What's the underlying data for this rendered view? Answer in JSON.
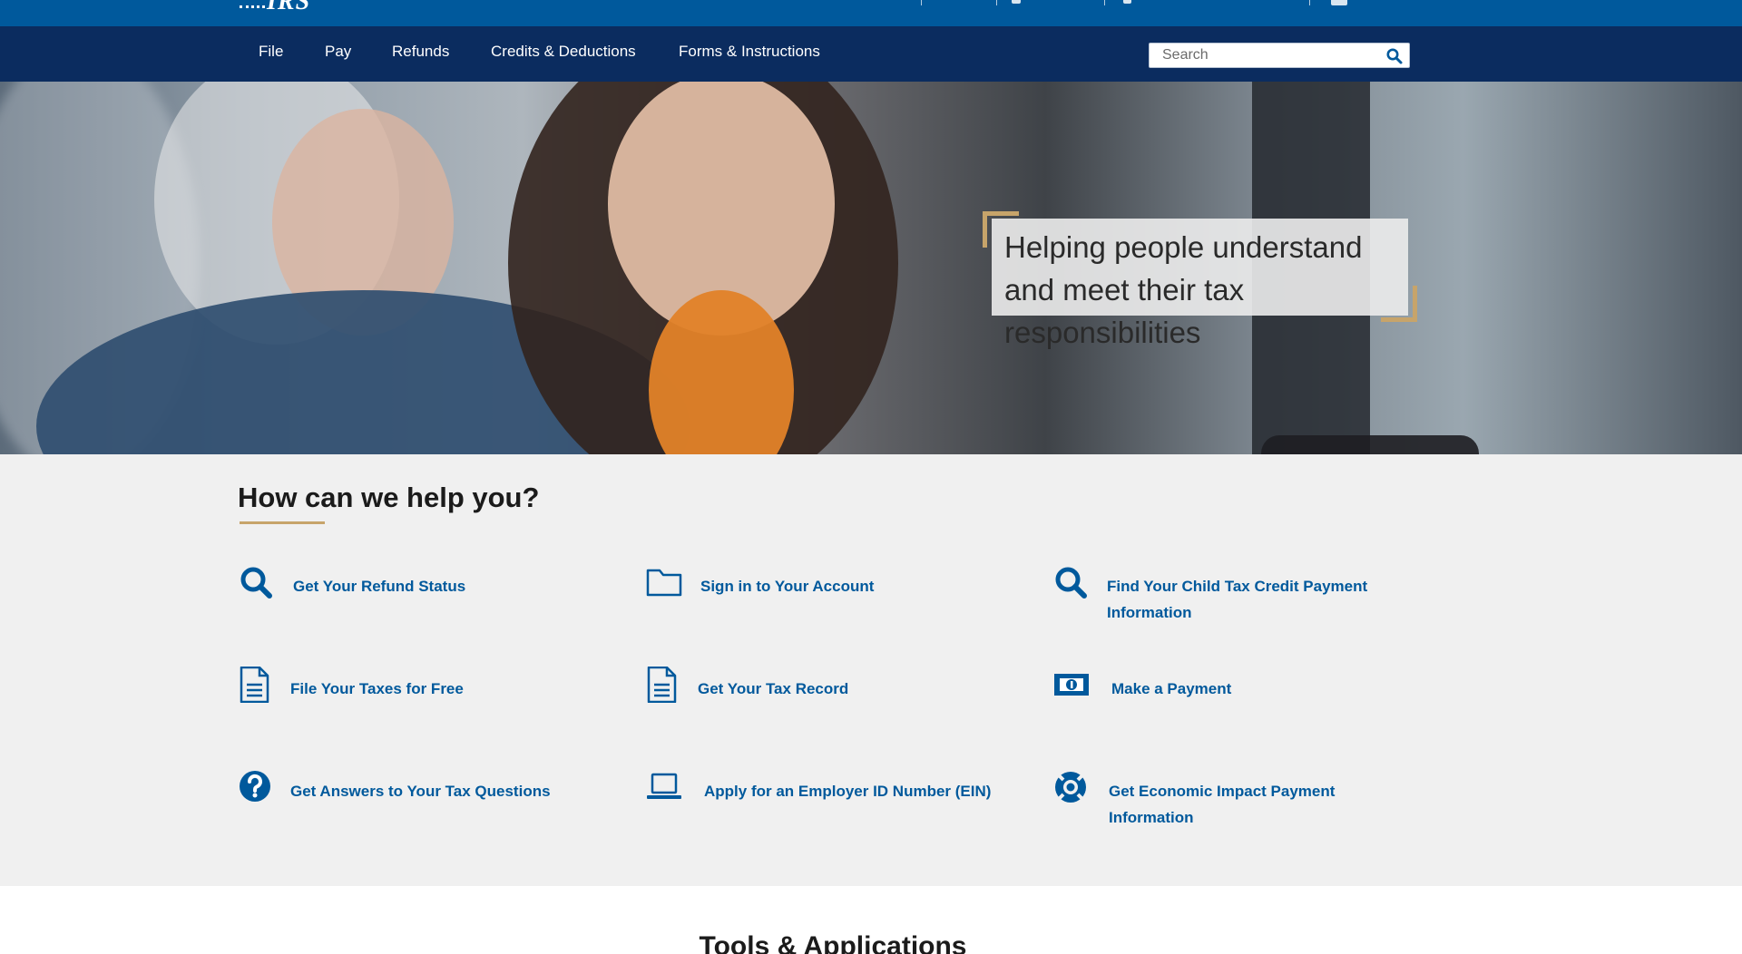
{
  "header": {
    "logo_text": "IRS"
  },
  "nav": {
    "items": [
      "File",
      "Pay",
      "Refunds",
      "Credits & Deductions",
      "Forms & Instructions"
    ],
    "search_placeholder": "Search"
  },
  "hero": {
    "tagline": "Helping people understand and meet their tax responsibilities"
  },
  "help": {
    "title": "How can we help you?",
    "items": [
      {
        "label": "Get Your Refund Status",
        "icon": "search-icon"
      },
      {
        "label": "Sign in to Your Account",
        "icon": "folder-icon"
      },
      {
        "label": "Find Your Child Tax Credit Payment Information",
        "icon": "search-icon"
      },
      {
        "label": "File Your Taxes for Free",
        "icon": "document-icon"
      },
      {
        "label": "Get Your Tax Record",
        "icon": "document-icon"
      },
      {
        "label": "Make a Payment",
        "icon": "money-icon"
      },
      {
        "label": "Get Answers to Your Tax Questions",
        "icon": "question-icon"
      },
      {
        "label": "Apply for an Employer ID Number (EIN)",
        "icon": "laptop-icon"
      },
      {
        "label": "Get Economic Impact Payment Information",
        "icon": "life-ring-icon"
      }
    ]
  },
  "tools": {
    "title": "Tools & Applications"
  },
  "colors": {
    "topbar": "#00599c",
    "navbar": "#0b2c5f",
    "link": "#00599c",
    "accent": "#c7a46a"
  }
}
